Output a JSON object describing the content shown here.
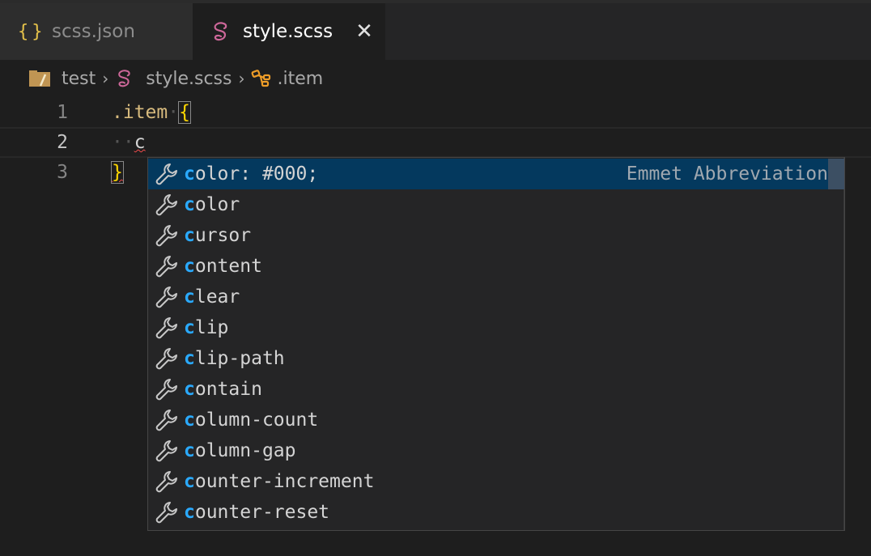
{
  "tabs": [
    {
      "label": "scss.json",
      "icon": "json-braces-icon",
      "glyph": "{}",
      "active": false
    },
    {
      "label": "style.scss",
      "icon": "sass-icon",
      "active": true,
      "close_glyph": "✕"
    }
  ],
  "breadcrumb": {
    "items": [
      {
        "label": "test",
        "icon": "folder-icon"
      },
      {
        "label": "style.scss",
        "icon": "sass-icon"
      },
      {
        "label": ".item",
        "icon": "symbol-class-icon"
      }
    ],
    "separator": "›"
  },
  "editor": {
    "lines": [
      {
        "number": "1",
        "selector": ".item",
        "brace": "{"
      },
      {
        "number": "2",
        "indent": "··",
        "typed": "c"
      },
      {
        "number": "3",
        "brace": "}"
      }
    ]
  },
  "suggestions": {
    "items": [
      {
        "match": "c",
        "rest": "olor: #000;",
        "detail": "Emmet Abbreviation",
        "selected": true
      },
      {
        "match": "c",
        "rest": "olor"
      },
      {
        "match": "c",
        "rest": "ursor"
      },
      {
        "match": "c",
        "rest": "ontent"
      },
      {
        "match": "c",
        "rest": "lear"
      },
      {
        "match": "c",
        "rest": "lip"
      },
      {
        "match": "c",
        "rest": "lip-path"
      },
      {
        "match": "c",
        "rest": "ontain"
      },
      {
        "match": "c",
        "rest": "olumn-count"
      },
      {
        "match": "c",
        "rest": "olumn-gap"
      },
      {
        "match": "c",
        "rest": "ounter-increment"
      },
      {
        "match": "c",
        "rest": "ounter-reset"
      }
    ]
  },
  "colors": {
    "accent_match": "#2aaaff",
    "selected_bg": "#04395e",
    "sass_pink": "#cd6799",
    "brace_gold": "#ffd700",
    "class_orange": "#ee9d28"
  }
}
